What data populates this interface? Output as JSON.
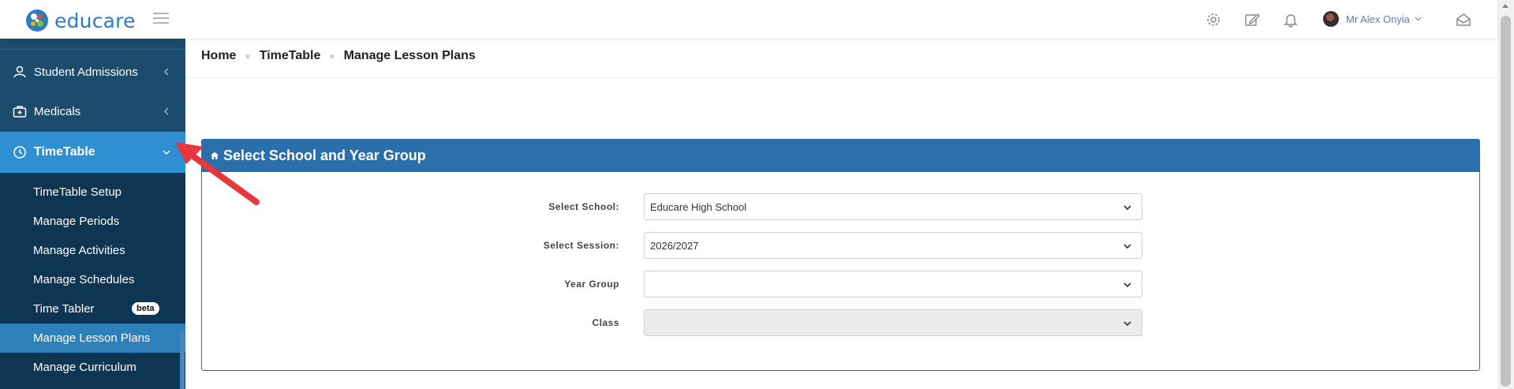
{
  "app": {
    "brand": "educare",
    "brand_color": "#2f7bbd",
    "sidebar_bg": "#1b4b6d",
    "accent": "#2f8fd3",
    "panel_color": "#2a6fab"
  },
  "topbar": {
    "icons": [
      "gear-icon",
      "edit-icon",
      "bell-icon",
      "envelope-open-icon"
    ],
    "user_name": "Mr Alex Onyia"
  },
  "sidebar": {
    "items": [
      {
        "label": "Student Admissions",
        "icon": "student-icon"
      },
      {
        "label": "Medicals",
        "icon": "medkit-icon"
      },
      {
        "label": "TimeTable",
        "icon": "clock-icon",
        "active": true
      }
    ],
    "submenu": [
      {
        "label": "TimeTable Setup"
      },
      {
        "label": "Manage Periods"
      },
      {
        "label": "Manage Activities"
      },
      {
        "label": "Manage Schedules"
      },
      {
        "label": "Time Tabler",
        "badge": "beta"
      },
      {
        "label": "Manage Lesson Plans",
        "current": true
      },
      {
        "label": "Manage Curriculum"
      }
    ]
  },
  "breadcrumb": [
    "Home",
    "TimeTable",
    "Manage Lesson Plans"
  ],
  "panel": {
    "title": "Select School and Year Group",
    "fields": [
      {
        "label": "Select School:",
        "value": "Educare High School"
      },
      {
        "label": "Select Session:",
        "value": "2026/2027"
      },
      {
        "label": "Year Group",
        "value": ""
      },
      {
        "label": "Class",
        "value": "",
        "disabled": true
      }
    ]
  }
}
